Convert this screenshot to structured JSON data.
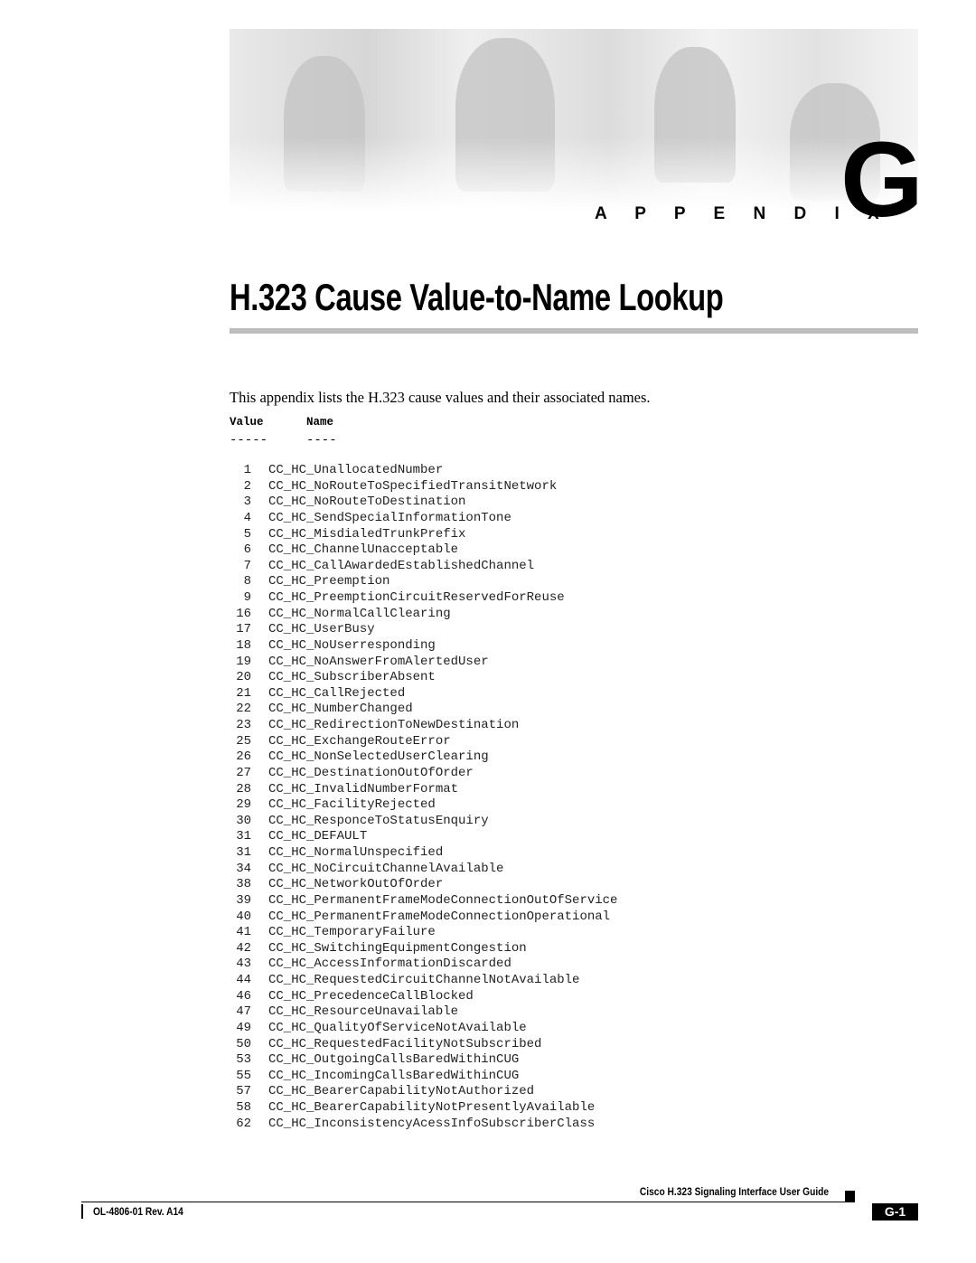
{
  "header": {
    "appendix_label": "A P P E N D I X",
    "appendix_letter": "G"
  },
  "title": "H.323 Cause Value-to-Name Lookup",
  "intro": "This appendix lists the H.323 cause values and their associated names.",
  "table": {
    "columns": [
      "Value",
      "Name"
    ],
    "underlines": [
      "-----",
      "----"
    ],
    "rows": [
      {
        "value": "1",
        "name": "CC_HC_UnallocatedNumber"
      },
      {
        "value": "2",
        "name": "CC_HC_NoRouteToSpecifiedTransitNetwork"
      },
      {
        "value": "3",
        "name": "CC_HC_NoRouteToDestination"
      },
      {
        "value": "4",
        "name": "CC_HC_SendSpecialInformationTone"
      },
      {
        "value": "5",
        "name": "CC_HC_MisdialedTrunkPrefix"
      },
      {
        "value": "6",
        "name": "CC_HC_ChannelUnacceptable"
      },
      {
        "value": "7",
        "name": "CC_HC_CallAwardedEstablishedChannel"
      },
      {
        "value": "8",
        "name": "CC_HC_Preemption"
      },
      {
        "value": "9",
        "name": "CC_HC_PreemptionCircuitReservedForReuse"
      },
      {
        "value": "16",
        "name": "CC_HC_NormalCallClearing"
      },
      {
        "value": "17",
        "name": "CC_HC_UserBusy"
      },
      {
        "value": "18",
        "name": "CC_HC_NoUserresponding"
      },
      {
        "value": "19",
        "name": "CC_HC_NoAnswerFromAlertedUser"
      },
      {
        "value": "20",
        "name": "CC_HC_SubscriberAbsent"
      },
      {
        "value": "21",
        "name": "CC_HC_CallRejected"
      },
      {
        "value": "22",
        "name": "CC_HC_NumberChanged"
      },
      {
        "value": "23",
        "name": "CC_HC_RedirectionToNewDestination"
      },
      {
        "value": "25",
        "name": "CC_HC_ExchangeRouteError"
      },
      {
        "value": "26",
        "name": "CC_HC_NonSelectedUserClearing"
      },
      {
        "value": "27",
        "name": "CC_HC_DestinationOutOfOrder"
      },
      {
        "value": "28",
        "name": "CC_HC_InvalidNumberFormat"
      },
      {
        "value": "29",
        "name": "CC_HC_FacilityRejected"
      },
      {
        "value": "30",
        "name": "CC_HC_ResponceToStatusEnquiry"
      },
      {
        "value": "31",
        "name": "CC_HC_DEFAULT"
      },
      {
        "value": "31",
        "name": "CC_HC_NormalUnspecified"
      },
      {
        "value": "34",
        "name": "CC_HC_NoCircuitChannelAvailable"
      },
      {
        "value": "38",
        "name": "CC_HC_NetworkOutOfOrder"
      },
      {
        "value": "39",
        "name": "CC_HC_PermanentFrameModeConnectionOutOfService"
      },
      {
        "value": "40",
        "name": "CC_HC_PermanentFrameModeConnectionOperational"
      },
      {
        "value": "41",
        "name": "CC_HC_TemporaryFailure"
      },
      {
        "value": "42",
        "name": "CC_HC_SwitchingEquipmentCongestion"
      },
      {
        "value": "43",
        "name": "CC_HC_AccessInformationDiscarded"
      },
      {
        "value": "44",
        "name": "CC_HC_RequestedCircuitChannelNotAvailable"
      },
      {
        "value": "46",
        "name": "CC_HC_PrecedenceCallBlocked"
      },
      {
        "value": "47",
        "name": "CC_HC_ResourceUnavailable"
      },
      {
        "value": "49",
        "name": "CC_HC_QualityOfServiceNotAvailable"
      },
      {
        "value": "50",
        "name": "CC_HC_RequestedFacilityNotSubscribed"
      },
      {
        "value": "53",
        "name": "CC_HC_OutgoingCallsBaredWithinCUG"
      },
      {
        "value": "55",
        "name": "CC_HC_IncomingCallsBaredWithinCUG"
      },
      {
        "value": "57",
        "name": "CC_HC_BearerCapabilityNotAuthorized"
      },
      {
        "value": "58",
        "name": "CC_HC_BearerCapabilityNotPresentlyAvailable"
      },
      {
        "value": "62",
        "name": "CC_HC_InconsistencyAcessInfoSubscriberClass"
      }
    ]
  },
  "footer": {
    "guide_title": "Cisco H.323 Signaling Interface User Guide",
    "doc_number": "OL-4806-01 Rev. A14",
    "page_number": "G-1"
  }
}
